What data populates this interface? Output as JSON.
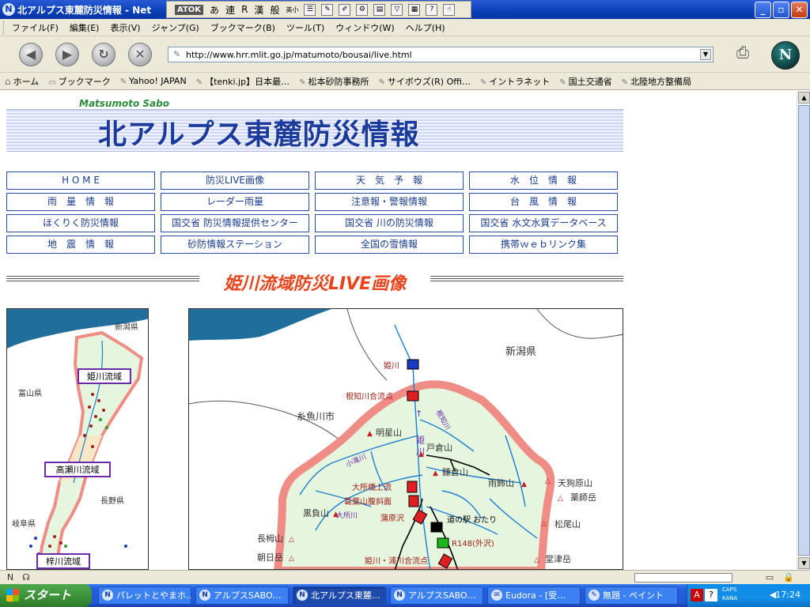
{
  "window": {
    "title": "北アルプス東麓防災情報 - Net",
    "app_icon_glyph": "N",
    "minimize_glyph": "_",
    "maximize_glyph": "▫",
    "close_glyph": "✕"
  },
  "ime": {
    "atok": "ATOK",
    "mode_hira": "あ",
    "mode_ren": "連",
    "mode_r": "R",
    "mode_kan": "漢",
    "mode_ban": "般",
    "mode_kana_small": "英小"
  },
  "menu": [
    "ファイル(F)",
    "編集(E)",
    "表示(V)",
    "ジャンプ(G)",
    "ブックマーク(B)",
    "ツール(T)",
    "ウィンドウ(W)",
    "ヘルプ(H)"
  ],
  "nav": {
    "back_glyph": "◀",
    "forward_glyph": "▶",
    "reload_glyph": "↻",
    "stop_glyph": "✕",
    "url": "http://www.hrr.mlit.go.jp/matumoto/bousai/live.html",
    "netscape_glyph": "N"
  },
  "bookmarks": [
    {
      "label": "ホーム",
      "kind": "home"
    },
    {
      "label": "ブックマーク",
      "kind": "folder"
    },
    {
      "label": "Yahoo! JAPAN",
      "kind": "link"
    },
    {
      "label": "【tenki.jp】日本最…",
      "kind": "link"
    },
    {
      "label": "松本砂防事務所",
      "kind": "link"
    },
    {
      "label": "サイボウズ(R) Offi…",
      "kind": "link"
    },
    {
      "label": "イントラネット",
      "kind": "link"
    },
    {
      "label": "国土交通省",
      "kind": "link"
    },
    {
      "label": "北陸地方整備局",
      "kind": "link"
    }
  ],
  "page": {
    "logo": "Matsumoto Sabo",
    "title": "北アルプス東麓防災情報",
    "links": [
      "H O M E",
      "防災LIVE画像",
      "天　気　予　報",
      "水　位　情　報",
      "雨　量　情　報",
      "レーダー雨量",
      "注意報・警報情報",
      "台　風　情　報",
      "ほくりく防災情報",
      "国交省 防災情報提供センター",
      "国交省 川の防災情報",
      "国交省 水文水質データベース",
      "地　震　情　報",
      "砂防情報ステーション",
      "全国の雪情報",
      "携帯ｗｅｂリンク集"
    ],
    "section_title": "姫川流域防災LIVE画像"
  },
  "overview_map": {
    "labels": {
      "niigata": "新潟県",
      "toyama": "富山県",
      "nagano": "長野県",
      "gifu": "岐阜県"
    },
    "basins": [
      "姫川流域",
      "高瀬川流域",
      "梓川流域"
    ]
  },
  "detail_map": {
    "prefecture": "新潟県",
    "city": "糸魚川市",
    "rivers": [
      "姫川",
      "根知川",
      "小滝川",
      "大所川"
    ],
    "river_vertical": "姫\n川",
    "arrow": "↑",
    "mountains": [
      "明星山",
      "戸倉山",
      "鎌倉山",
      "雨飾山",
      "天狗原山",
      "薬師岳",
      "黒負山",
      "松尾山",
      "長栂山",
      "朝日岳",
      "堂津岳"
    ],
    "cameras": [
      "姫川",
      "根知川合流点",
      "大所橋上流",
      "葛葉山腹斜面",
      "蒲原沢",
      "道の駅\nおたり",
      "R148(外沢)",
      "姫川・浦川合流点"
    ],
    "colors": {
      "sea": "#1f6e9c",
      "basin": "#e6f5de",
      "border": "#ef8c86",
      "river": "#1a7fd0"
    }
  },
  "status": {
    "status_icons": [
      "N",
      "☊",
      "▭",
      "🔒"
    ]
  },
  "taskbar": {
    "start": "スタート",
    "buttons": [
      "パレットとやまホ…",
      "アルプスSABO…",
      "北アルプス東麓…",
      "アルプスSABO…",
      "Eudora - [受…",
      "無題 - ペイント"
    ],
    "caps": "CAPS",
    "kana": "KANA",
    "clock": "17:24"
  }
}
